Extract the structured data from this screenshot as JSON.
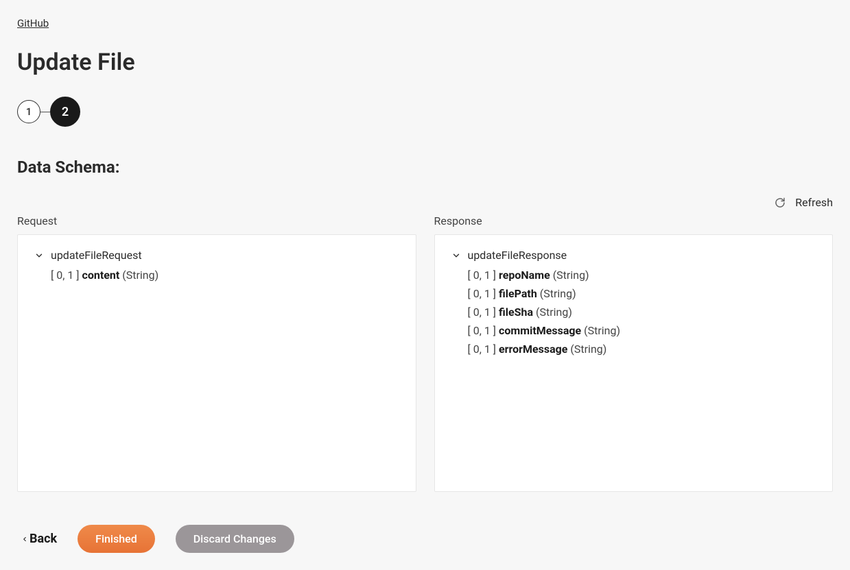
{
  "breadcrumb": "GitHub",
  "page_title": "Update File",
  "stepper": {
    "step1": "1",
    "step2": "2"
  },
  "section_title": "Data Schema:",
  "refresh_label": "Refresh",
  "request": {
    "label": "Request",
    "root": "updateFileRequest",
    "fields": [
      {
        "card": "[ 0, 1 ]",
        "name": "content",
        "type": "(String)"
      }
    ]
  },
  "response": {
    "label": "Response",
    "root": "updateFileResponse",
    "fields": [
      {
        "card": "[ 0, 1 ]",
        "name": "repoName",
        "type": "(String)"
      },
      {
        "card": "[ 0, 1 ]",
        "name": "filePath",
        "type": "(String)"
      },
      {
        "card": "[ 0, 1 ]",
        "name": "fileSha",
        "type": "(String)"
      },
      {
        "card": "[ 0, 1 ]",
        "name": "commitMessage",
        "type": "(String)"
      },
      {
        "card": "[ 0, 1 ]",
        "name": "errorMessage",
        "type": "(String)"
      }
    ]
  },
  "footer": {
    "back": "Back",
    "finished": "Finished",
    "discard": "Discard Changes"
  }
}
